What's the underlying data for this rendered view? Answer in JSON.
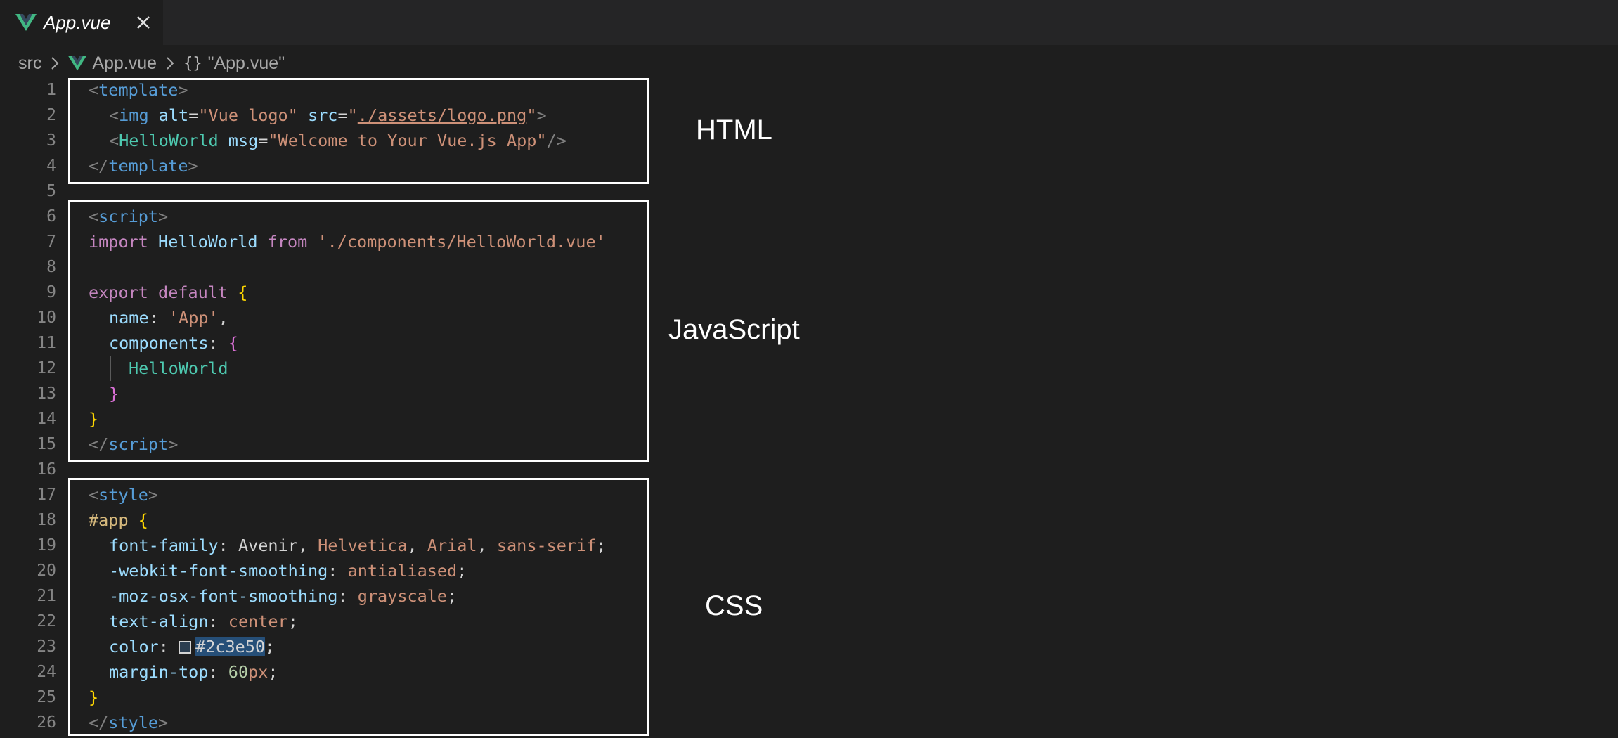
{
  "tab": {
    "title": "App.vue",
    "icon": "vue-logo-icon",
    "close_icon": "close-icon"
  },
  "breadcrumb": {
    "items": [
      "src",
      "App.vue",
      "\"App.vue\""
    ],
    "braces": "{}"
  },
  "line_numbers": [
    "1",
    "2",
    "3",
    "4",
    "5",
    "6",
    "7",
    "8",
    "9",
    "10",
    "11",
    "12",
    "13",
    "14",
    "15",
    "16",
    "17",
    "18",
    "19",
    "20",
    "21",
    "22",
    "23",
    "24",
    "25",
    "26"
  ],
  "code": {
    "l1": {
      "open": "<",
      "tag": "template",
      "close": ">"
    },
    "l2": {
      "open": "<",
      "tag": "img",
      "attr1": "alt",
      "eq1": "=",
      "val1": "\"Vue logo\"",
      "attr2": "src",
      "eq2": "=",
      "q1": "\"",
      "link": "./assets/logo.png",
      "q2": "\"",
      "close": ">"
    },
    "l3": {
      "open": "<",
      "tag": "HelloWorld",
      "attr": "msg",
      "eq": "=",
      "val": "\"Welcome to Your Vue.js App\"",
      "close": "/>"
    },
    "l4": {
      "open": "</",
      "tag": "template",
      "close": ">"
    },
    "l6": {
      "open": "<",
      "tag": "script",
      "close": ">"
    },
    "l7": {
      "kw1": "import",
      "name": "HelloWorld",
      "kw2": "from",
      "path": "'./components/HelloWorld.vue'"
    },
    "l9": {
      "kw1": "export",
      "kw2": "default",
      "brace": "{"
    },
    "l10": {
      "prop": "name",
      "colon": ":",
      "val": "'App'",
      "comma": ","
    },
    "l11": {
      "prop": "components",
      "colon": ":",
      "brace": "{"
    },
    "l12": {
      "name": "HelloWorld"
    },
    "l13": {
      "brace": "}"
    },
    "l14": {
      "brace": "}"
    },
    "l15": {
      "open": "</",
      "tag": "script",
      "close": ">"
    },
    "l17": {
      "open": "<",
      "tag": "style",
      "close": ">"
    },
    "l18": {
      "sel": "#app",
      "brace": "{"
    },
    "l19": {
      "prop": "font-family",
      "colon": ":",
      "v1": "Avenir,",
      "v2": "Helvetica",
      "c2": ",",
      "v3": "Arial",
      "c3": ",",
      "v4": "sans-serif",
      "semi": ";"
    },
    "l20": {
      "prop": "-webkit-font-smoothing",
      "colon": ":",
      "val": "antialiased",
      "semi": ";"
    },
    "l21": {
      "prop": "-moz-osx-font-smoothing",
      "colon": ":",
      "val": "grayscale",
      "semi": ";"
    },
    "l22": {
      "prop": "text-align",
      "colon": ":",
      "val": "center",
      "semi": ";"
    },
    "l23": {
      "prop": "color",
      "colon": ":",
      "val": "#2c3e50",
      "semi": ";"
    },
    "l24": {
      "prop": "margin-top",
      "colon": ":",
      "num": "60",
      "unit": "px",
      "semi": ";"
    },
    "l25": {
      "brace": "}"
    },
    "l26": {
      "open": "</",
      "tag": "style",
      "close": ">"
    }
  },
  "annotations": {
    "html": "HTML",
    "js": "JavaScript",
    "css": "CSS"
  },
  "colors": {
    "background": "#1e1e1e",
    "tab_bar": "#252526",
    "tag": "#569cd6",
    "component": "#4ec9b0",
    "attribute": "#9cdcfe",
    "string": "#ce9178",
    "keyword": "#c586c0",
    "brace": "#ffd700",
    "selector": "#d7ba7d",
    "number": "#b5cea8",
    "swatch": "#2c3e50"
  }
}
